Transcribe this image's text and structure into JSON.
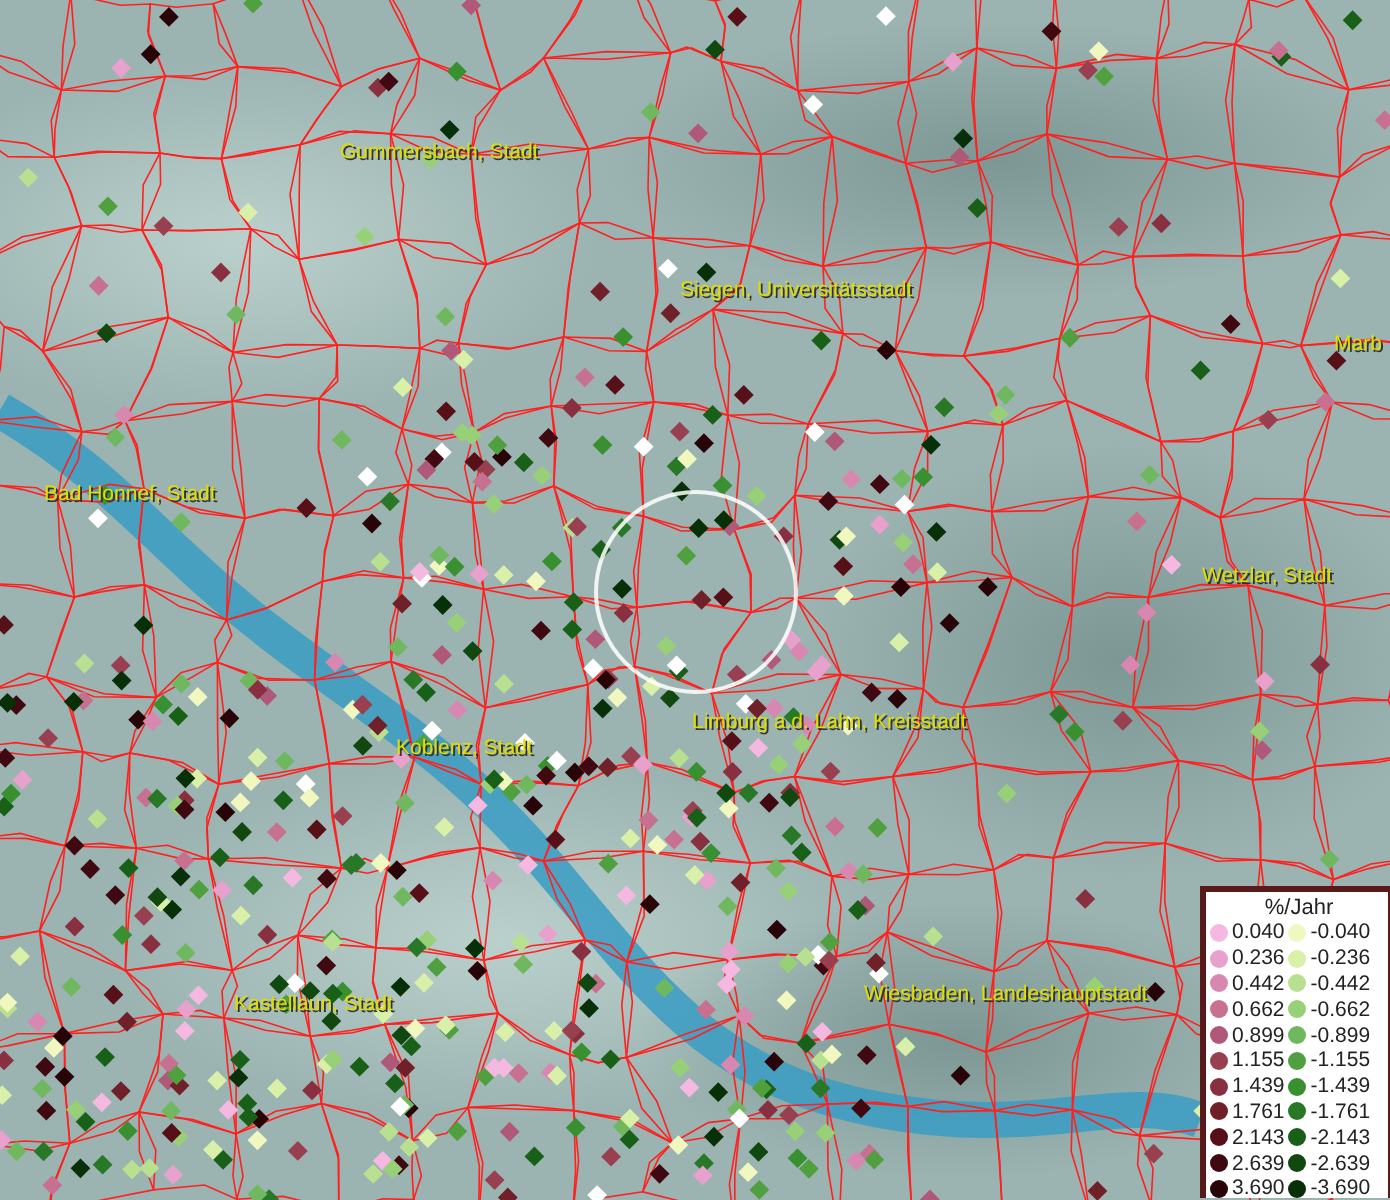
{
  "map": {
    "labels": [
      {
        "text": "Gummersbach, Stadt"
      },
      {
        "text": "Siegen, Universitätsstadt"
      },
      {
        "text": "Marb"
      },
      {
        "text": "Bad Honnef, Stadt"
      },
      {
        "text": "Wetzlar, Stadt"
      },
      {
        "text": "Limburg a.d. Lahn, Kreisstadt"
      },
      {
        "text": "Koblenz, Stadt"
      },
      {
        "text": "Kastellaun, Stadt"
      },
      {
        "text": "Wiesbaden, Landeshauptstadt"
      }
    ]
  },
  "legend": {
    "title": "%/Jahr",
    "positive": [
      {
        "value": "0.040",
        "color": "#f5b8e0"
      },
      {
        "value": "0.236",
        "color": "#e8a0cc"
      },
      {
        "value": "0.442",
        "color": "#d888b0"
      },
      {
        "value": "0.662",
        "color": "#c87090"
      },
      {
        "value": "0.899",
        "color": "#b05878"
      },
      {
        "value": "1.155",
        "color": "#984050"
      },
      {
        "value": "1.439",
        "color": "#883040"
      },
      {
        "value": "1.761",
        "color": "#702028"
      },
      {
        "value": "2.143",
        "color": "#581018"
      },
      {
        "value": "2.639",
        "color": "#400810"
      },
      {
        "value": "3.690",
        "color": "#280408"
      }
    ],
    "negative": [
      {
        "value": "-0.040",
        "color": "#f0f8c0"
      },
      {
        "value": "-0.236",
        "color": "#d8f0a8"
      },
      {
        "value": "-0.442",
        "color": "#b8e090"
      },
      {
        "value": "-0.662",
        "color": "#98d078"
      },
      {
        "value": "-0.899",
        "color": "#70b860"
      },
      {
        "value": "-1.155",
        "color": "#50a040"
      },
      {
        "value": "-1.439",
        "color": "#389030"
      },
      {
        "value": "-1.761",
        "color": "#287828"
      },
      {
        "value": "-2.143",
        "color": "#186018"
      },
      {
        "value": "-2.639",
        "color": "#104810"
      },
      {
        "value": "-3.690",
        "color": "#083008"
      }
    ]
  }
}
